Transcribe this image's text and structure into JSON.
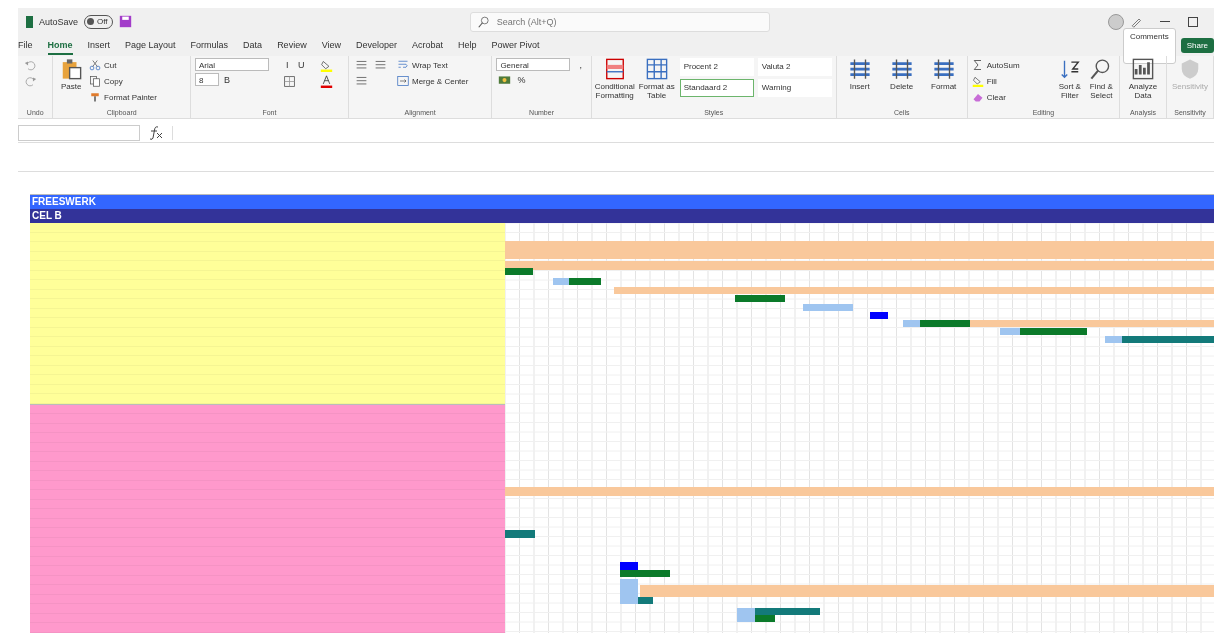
{
  "title_bar": {
    "autosave": {
      "label": "AutoSave",
      "state": "Off",
      "on": false
    },
    "search": {
      "placeholder": "Search (Alt+Q)"
    }
  },
  "menu_tabs": [
    {
      "label": "File",
      "selected": false
    },
    {
      "label": "Home",
      "selected": true
    },
    {
      "label": "Insert",
      "selected": false
    },
    {
      "label": "Page Layout",
      "selected": false
    },
    {
      "label": "Formulas",
      "selected": false
    },
    {
      "label": "Data",
      "selected": false
    },
    {
      "label": "Review",
      "selected": false
    },
    {
      "label": "View",
      "selected": false
    },
    {
      "label": "Developer",
      "selected": false
    },
    {
      "label": "Acrobat",
      "selected": false
    },
    {
      "label": "Help",
      "selected": false
    },
    {
      "label": "Power Pivot",
      "selected": false
    }
  ],
  "header_buttons": [
    {
      "label": "Comments",
      "kind": "outline"
    },
    {
      "label": "Share",
      "kind": "primary"
    }
  ],
  "ribbon": [
    {
      "label": "Undo",
      "items": [
        {
          "kind": "icon"
        },
        {
          "kind": "icon"
        }
      ]
    },
    {
      "label": "Clipboard",
      "items": [
        {
          "kind": "large",
          "label": "Paste"
        },
        {
          "kind": "small",
          "label": "Cut"
        },
        {
          "kind": "small",
          "label": "Copy"
        },
        {
          "kind": "small",
          "label": "Format Painter"
        }
      ]
    },
    {
      "label": "Font",
      "items": [
        {
          "kind": "field",
          "label": "Arial"
        },
        {
          "kind": "field",
          "label": "8"
        },
        {
          "kind": "text",
          "label": "B"
        },
        {
          "kind": "text",
          "label": "I"
        },
        {
          "kind": "text",
          "label": "U"
        },
        {
          "kind": "icon"
        },
        {
          "kind": "icon"
        },
        {
          "kind": "icon"
        }
      ]
    },
    {
      "label": "Alignment",
      "items": [
        {
          "kind": "icon"
        },
        {
          "kind": "icon"
        },
        {
          "kind": "icon"
        },
        {
          "kind": "small",
          "label": "Wrap Text"
        },
        {
          "kind": "small",
          "label": "Merge & Center"
        }
      ]
    },
    {
      "label": "Number",
      "items": [
        {
          "kind": "field",
          "label": "General"
        },
        {
          "kind": "icon"
        },
        {
          "kind": "text",
          "label": "%"
        },
        {
          "kind": "text",
          "label": ","
        }
      ]
    },
    {
      "label": "Styles",
      "items": [
        {
          "kind": "large",
          "label": "Conditional Formatting"
        },
        {
          "kind": "large",
          "label": "Format as Table"
        },
        {
          "kind": "style",
          "label": "Procent 2",
          "selected": false
        },
        {
          "kind": "style",
          "label": "Standaard 2",
          "selected": true
        },
        {
          "kind": "style",
          "label": "Valuta 2",
          "selected": false
        },
        {
          "kind": "style",
          "label": "Warning",
          "selected": false
        }
      ]
    },
    {
      "label": "Cells",
      "items": [
        {
          "kind": "large",
          "label": "Insert"
        },
        {
          "kind": "large",
          "label": "Delete"
        },
        {
          "kind": "large",
          "label": "Format"
        }
      ]
    },
    {
      "label": "Editing",
      "items": [
        {
          "kind": "small",
          "label": "AutoSum"
        },
        {
          "kind": "small",
          "label": "Fill"
        },
        {
          "kind": "small",
          "label": "Clear"
        },
        {
          "kind": "large",
          "label": "Sort & Filter"
        },
        {
          "kind": "large",
          "label": "Find & Select"
        }
      ]
    },
    {
      "label": "Analysis",
      "items": [
        {
          "kind": "large",
          "label": "Analyze Data"
        }
      ]
    },
    {
      "label": "Sensitivity",
      "items": [
        {
          "kind": "large",
          "label": "Sensitivity",
          "disabled": true
        }
      ]
    }
  ],
  "sheet": {
    "bands": [
      {
        "label": "FREESWERK",
        "color": "#3366ff"
      },
      {
        "label": "CEL B",
        "color": "#333399"
      }
    ],
    "row_groups": [
      {
        "color": "#ffff99"
      },
      {
        "color": "#ff99cc"
      }
    ]
  }
}
